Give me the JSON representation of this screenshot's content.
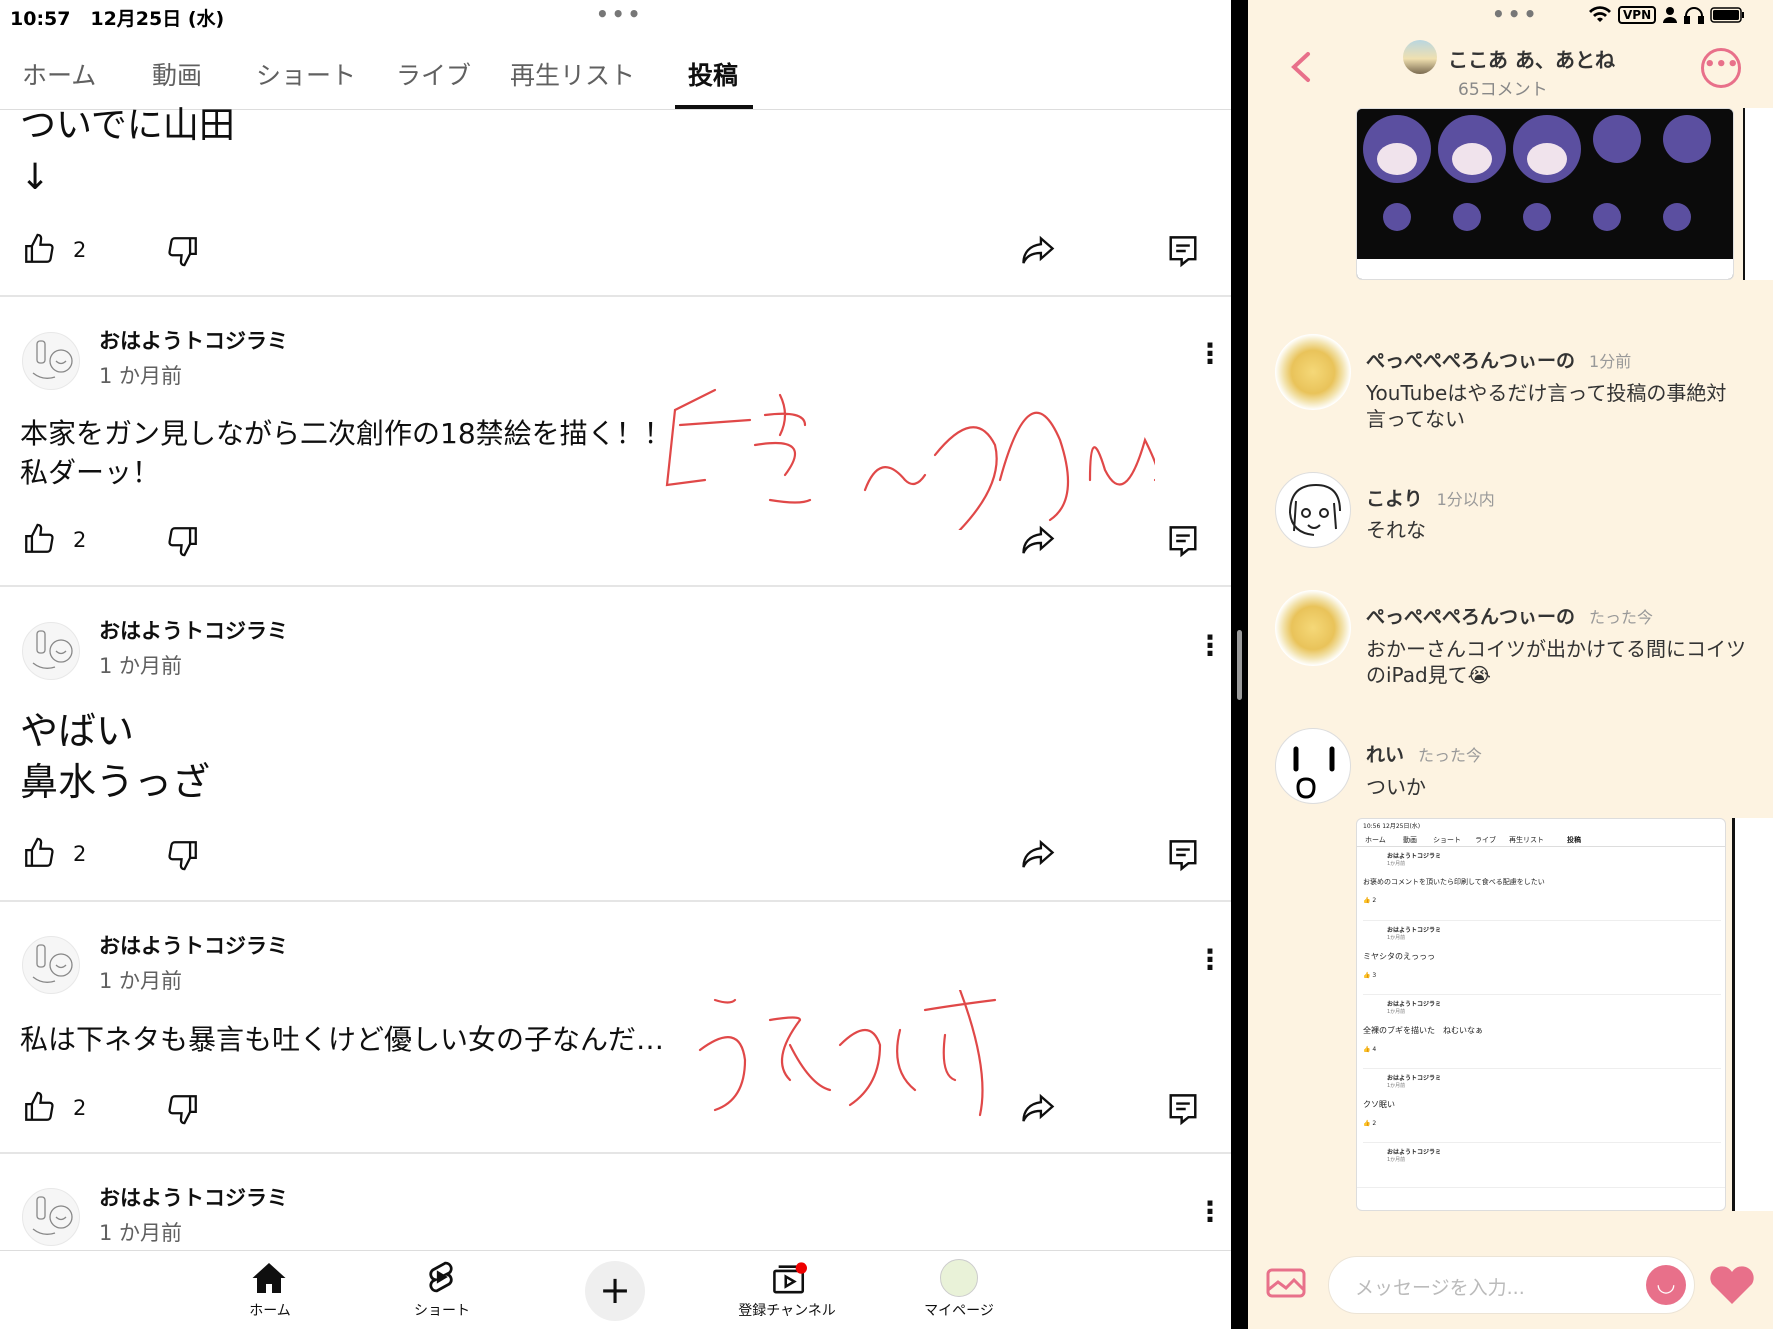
{
  "status": {
    "time": "10:57",
    "date": "12月25日 (水)",
    "vpn": "VPN"
  },
  "tabs": [
    {
      "label": "ホーム"
    },
    {
      "label": "動画"
    },
    {
      "label": "ショート"
    },
    {
      "label": "ライブ"
    },
    {
      "label": "再生リスト"
    },
    {
      "label": "投稿",
      "active": true
    }
  ],
  "posts": [
    {
      "body_line1": "ついでに山田",
      "body_line2": "↓",
      "likes": "2"
    },
    {
      "author": "おはようトコジラミ",
      "time": "1 か月前",
      "body_line1": "本家をガン見しながら二次創作の18禁絵を描く！！",
      "body_line2": "私ダーッ！",
      "likes": "2"
    },
    {
      "author": "おはようトコジラミ",
      "time": "1 か月前",
      "body_line1": "やばい",
      "body_line2": "鼻水うっざ",
      "likes": "2"
    },
    {
      "author": "おはようトコジラミ",
      "time": "1 か月前",
      "body_line1": "私は下ネタも暴言も吐くけど優しい女の子なんだ…",
      "likes": "2"
    },
    {
      "author": "おはようトコジラミ",
      "time": "1 か月前"
    }
  ],
  "bottom_nav": [
    {
      "label": "ホーム",
      "icon": "home-icon"
    },
    {
      "label": "ショート",
      "icon": "shorts-icon"
    },
    {
      "label": "",
      "icon": "plus-icon"
    },
    {
      "label": "登録チャンネル",
      "icon": "subscriptions-icon"
    },
    {
      "label": "マイページ",
      "icon": "profile-avatar"
    }
  ],
  "chat": {
    "title": "ここあ あ、あとね",
    "subtitle": "65コメント",
    "comments": [
      {
        "name": "ぺっぺぺぺろんつぃーの",
        "time": "1分前",
        "line1": "YouTubeはやるだけ言って投稿の事絶対",
        "line2": "言ってない"
      },
      {
        "name": "こより",
        "time": "1分以内",
        "line1": "それな"
      },
      {
        "name": "ぺっぺぺぺろんつぃーの",
        "time": "たった今",
        "line1": "おかーさんコイツが出かけてる間にコイツ",
        "line2": "のiPad見て😭"
      },
      {
        "name": "れい",
        "time": "たった今",
        "line1": "ついか"
      }
    ],
    "input_placeholder": "メッセージを入力...",
    "mini_screenshot": {
      "status": "10:56  12月25日(水)",
      "tabs": [
        "ホーム",
        "動画",
        "ショート",
        "ライブ",
        "再生リスト",
        "投稿"
      ],
      "posts": [
        {
          "author": "おはようトコジラミ",
          "time": "1か月前",
          "text": "お褒めのコメントを頂いたら印刷して食べる配慮をしたい",
          "likes": "2"
        },
        {
          "author": "おはようトコジラミ",
          "time": "1か月前",
          "text": "ミヤシタのえっっっ",
          "likes": "3"
        },
        {
          "author": "おはようトコジラミ",
          "time": "1か月前",
          "text": "全裸のブギを描いた　ねむいなぁ",
          "likes": "4"
        },
        {
          "author": "おはようトコジラミ",
          "time": "1か月前",
          "text": "クソ眠い",
          "likes": "2"
        },
        {
          "author": "おはようトコジラミ",
          "time": "1か月前",
          "text": ""
        }
      ]
    }
  },
  "colors": {
    "chat_bg": "#fdf3e1",
    "accent_pink": "#e8708a",
    "ink_red": "#e04848"
  }
}
